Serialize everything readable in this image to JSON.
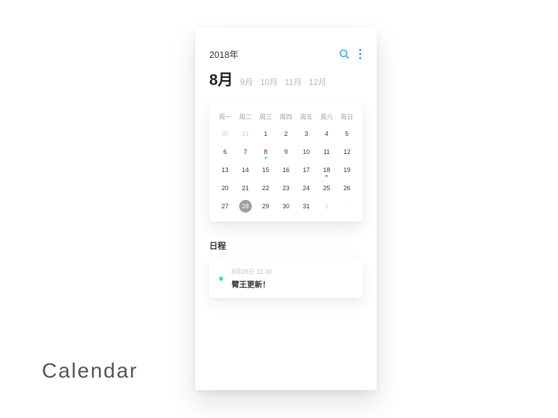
{
  "brand": "Calendar",
  "header": {
    "year": "2018年"
  },
  "months": {
    "current": "8月",
    "others": [
      "9月",
      "10月",
      "11月",
      "12月"
    ]
  },
  "weekdays": [
    "周一",
    "周二",
    "周三",
    "周四",
    "周五",
    "周六",
    "周日"
  ],
  "days": [
    {
      "n": "30",
      "muted": true
    },
    {
      "n": "31",
      "muted": true
    },
    {
      "n": "1"
    },
    {
      "n": "2"
    },
    {
      "n": "3"
    },
    {
      "n": "4"
    },
    {
      "n": "5"
    },
    {
      "n": "6"
    },
    {
      "n": "7"
    },
    {
      "n": "8",
      "mark": "cyan"
    },
    {
      "n": "9"
    },
    {
      "n": "10"
    },
    {
      "n": "11"
    },
    {
      "n": "12"
    },
    {
      "n": "13"
    },
    {
      "n": "14"
    },
    {
      "n": "15"
    },
    {
      "n": "16"
    },
    {
      "n": "17"
    },
    {
      "n": "18",
      "mark": "blue"
    },
    {
      "n": "19"
    },
    {
      "n": "20"
    },
    {
      "n": "21"
    },
    {
      "n": "22"
    },
    {
      "n": "23"
    },
    {
      "n": "24"
    },
    {
      "n": "25"
    },
    {
      "n": "26"
    },
    {
      "n": "27"
    },
    {
      "n": "28",
      "selected": true
    },
    {
      "n": "29"
    },
    {
      "n": "30"
    },
    {
      "n": "31"
    },
    {
      "n": "1",
      "muted": true
    },
    {
      "n": "·",
      "muted": true
    }
  ],
  "schedule": {
    "title": "日程",
    "event": {
      "meta": "8月28日  22:30",
      "title": "臂王更新！"
    }
  }
}
